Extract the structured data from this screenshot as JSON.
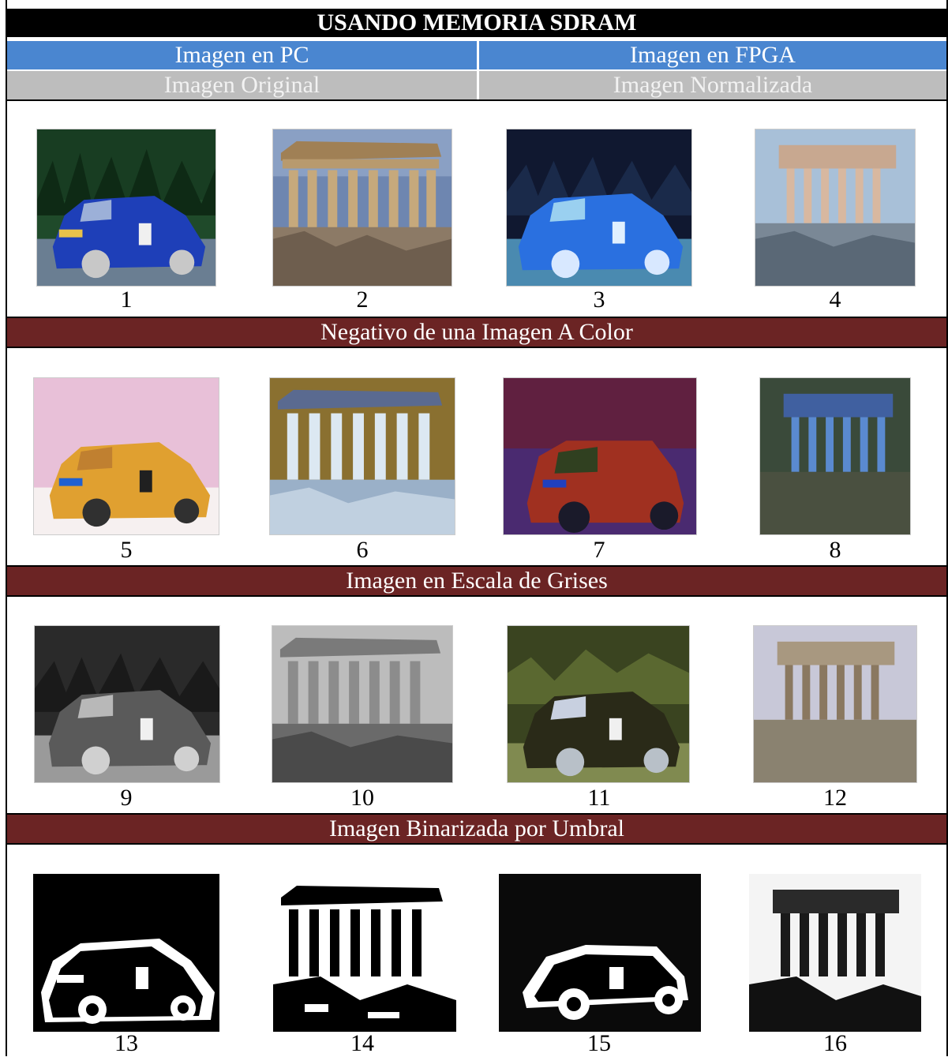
{
  "title": "USANDO MEMORIA SDRAM",
  "headers": {
    "pc": "Imagen en PC",
    "fpga": "Imagen en FPGA",
    "original": "Imagen Original",
    "normalizada": "Imagen Normalizada"
  },
  "sections": [
    "Negativo de una Imagen A Color",
    "Imagen en Escala de Grises",
    "Imagen Binarizada por Umbral"
  ],
  "numbers": [
    "1",
    "2",
    "3",
    "4",
    "5",
    "6",
    "7",
    "8",
    "9",
    "10",
    "11",
    "12",
    "13",
    "14",
    "15",
    "16"
  ]
}
